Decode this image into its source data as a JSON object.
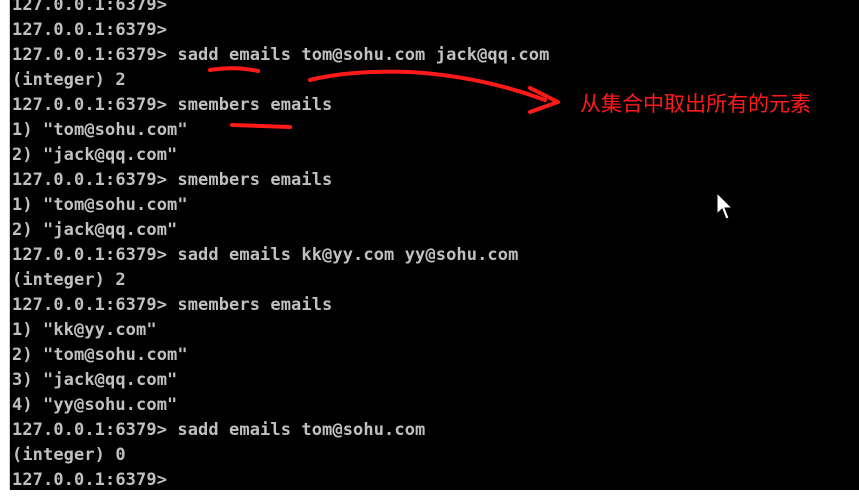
{
  "terminal": {
    "lines": [
      "127.0.0.1:6379>",
      "127.0.0.1:6379>",
      "127.0.0.1:6379> sadd emails tom@sohu.com jack@qq.com",
      "(integer) 2",
      "127.0.0.1:6379> smembers emails",
      "1) \"tom@sohu.com\"",
      "2) \"jack@qq.com\"",
      "127.0.0.1:6379> smembers emails",
      "1) \"tom@sohu.com\"",
      "2) \"jack@qq.com\"",
      "127.0.0.1:6379> sadd emails kk@yy.com yy@sohu.com",
      "(integer) 2",
      "127.0.0.1:6379> smembers emails",
      "1) \"kk@yy.com\"",
      "2) \"tom@sohu.com\"",
      "3) \"jack@qq.com\"",
      "4) \"yy@sohu.com\"",
      "127.0.0.1:6379> sadd emails tom@sohu.com",
      "(integer) 0",
      "127.0.0.1:6379>"
    ]
  },
  "annotation": {
    "text": "从集合中取出所有的元素"
  },
  "colors": {
    "background": "#000000",
    "text": "#c0c0c0",
    "annotation": "#ff1a1a"
  },
  "icons": {
    "cursor": "mouse-pointer-icon",
    "arrow": "red-arrow-icon"
  }
}
